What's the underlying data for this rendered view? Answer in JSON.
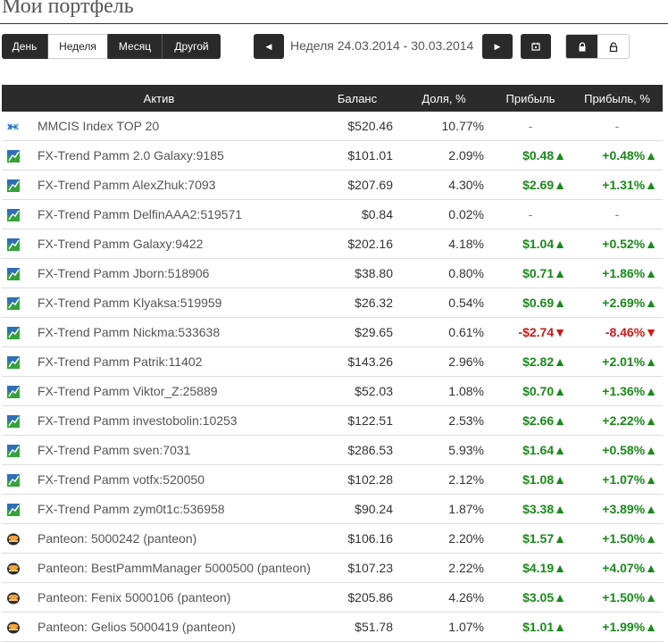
{
  "page": {
    "title": "Мои портфель"
  },
  "period_buttons": [
    {
      "label": "День",
      "active": false
    },
    {
      "label": "Неделя",
      "active": true
    },
    {
      "label": "Месяц",
      "active": false
    },
    {
      "label": "Другой",
      "active": false
    }
  ],
  "date_range": "Неделя 24.03.2014 - 30.03.2014",
  "colors": {
    "header_bg": "#2b2b2b",
    "positive": "#1a8a1a",
    "negative": "#d01818"
  },
  "table": {
    "columns": {
      "asset": "Актив",
      "balance": "Баланс",
      "share": "Доля, %",
      "profit": "Прибыль",
      "profit_pct": "Прибыль, %"
    },
    "rows": [
      {
        "icon": "mmcis-logo-icon",
        "name": "MMCIS Index TOP 20",
        "balance": "$520.46",
        "share": "10.77%",
        "profit": "-",
        "profit_pct": "-",
        "trend": "none"
      },
      {
        "icon": "fx-trend-logo-icon",
        "name": "FX-Trend Pamm 2.0 Galaxy:9185",
        "balance": "$101.01",
        "share": "2.09%",
        "profit": "$0.48",
        "profit_pct": "+0.48%",
        "trend": "up"
      },
      {
        "icon": "fx-trend-logo-icon",
        "name": "FX-Trend Pamm AlexZhuk:7093",
        "balance": "$207.69",
        "share": "4.30%",
        "profit": "$2.69",
        "profit_pct": "+1.31%",
        "trend": "up"
      },
      {
        "icon": "fx-trend-logo-icon",
        "name": "FX-Trend Pamm DelfinAAA2:519571",
        "balance": "$0.84",
        "share": "0.02%",
        "profit": "-",
        "profit_pct": "-",
        "trend": "none"
      },
      {
        "icon": "fx-trend-logo-icon",
        "name": "FX-Trend Pamm Galaxy:9422",
        "balance": "$202.16",
        "share": "4.18%",
        "profit": "$1.04",
        "profit_pct": "+0.52%",
        "trend": "up"
      },
      {
        "icon": "fx-trend-logo-icon",
        "name": "FX-Trend Pamm Jborn:518906",
        "balance": "$38.80",
        "share": "0.80%",
        "profit": "$0.71",
        "profit_pct": "+1.86%",
        "trend": "up"
      },
      {
        "icon": "fx-trend-logo-icon",
        "name": "FX-Trend Pamm Klyaksa:519959",
        "balance": "$26.32",
        "share": "0.54%",
        "profit": "$0.69",
        "profit_pct": "+2.69%",
        "trend": "up"
      },
      {
        "icon": "fx-trend-logo-icon",
        "name": "FX-Trend Pamm Nickma:533638",
        "balance": "$29.65",
        "share": "0.61%",
        "profit": "-$2.74",
        "profit_pct": "-8.46%",
        "trend": "down"
      },
      {
        "icon": "fx-trend-logo-icon",
        "name": "FX-Trend Pamm Patrik:11402",
        "balance": "$143.26",
        "share": "2.96%",
        "profit": "$2.82",
        "profit_pct": "+2.01%",
        "trend": "up"
      },
      {
        "icon": "fx-trend-logo-icon",
        "name": "FX-Trend Pamm Viktor_Z:25889",
        "balance": "$52.03",
        "share": "1.08%",
        "profit": "$0.70",
        "profit_pct": "+1.36%",
        "trend": "up"
      },
      {
        "icon": "fx-trend-logo-icon",
        "name": "FX-Trend Pamm investobolin:10253",
        "balance": "$122.51",
        "share": "2.53%",
        "profit": "$2.66",
        "profit_pct": "+2.22%",
        "trend": "up"
      },
      {
        "icon": "fx-trend-logo-icon",
        "name": "FX-Trend Pamm sven:7031",
        "balance": "$286.53",
        "share": "5.93%",
        "profit": "$1.64",
        "profit_pct": "+0.58%",
        "trend": "up"
      },
      {
        "icon": "fx-trend-logo-icon",
        "name": "FX-Trend Pamm votfx:520050",
        "balance": "$102.28",
        "share": "2.12%",
        "profit": "$1.08",
        "profit_pct": "+1.07%",
        "trend": "up"
      },
      {
        "icon": "fx-trend-logo-icon",
        "name": "FX-Trend Pamm zym0t1c:536958",
        "balance": "$90.24",
        "share": "1.87%",
        "profit": "$3.38",
        "profit_pct": "+3.89%",
        "trend": "up"
      },
      {
        "icon": "panteon-logo-icon",
        "name": "Panteon: 5000242 (panteon)",
        "balance": "$106.16",
        "share": "2.20%",
        "profit": "$1.57",
        "profit_pct": "+1.50%",
        "trend": "up"
      },
      {
        "icon": "panteon-logo-icon",
        "name": "Panteon: BestPammManager 5000500 (panteon)",
        "balance": "$107.23",
        "share": "2.22%",
        "profit": "$4.19",
        "profit_pct": "+4.07%",
        "trend": "up"
      },
      {
        "icon": "panteon-logo-icon",
        "name": "Panteon: Fenix 5000106 (panteon)",
        "balance": "$205.86",
        "share": "4.26%",
        "profit": "$3.05",
        "profit_pct": "+1.50%",
        "trend": "up"
      },
      {
        "icon": "panteon-logo-icon",
        "name": "Panteon: Gelios 5000419 (panteon)",
        "balance": "$51.78",
        "share": "1.07%",
        "profit": "$1.01",
        "profit_pct": "+1.99%",
        "trend": "up"
      }
    ]
  }
}
